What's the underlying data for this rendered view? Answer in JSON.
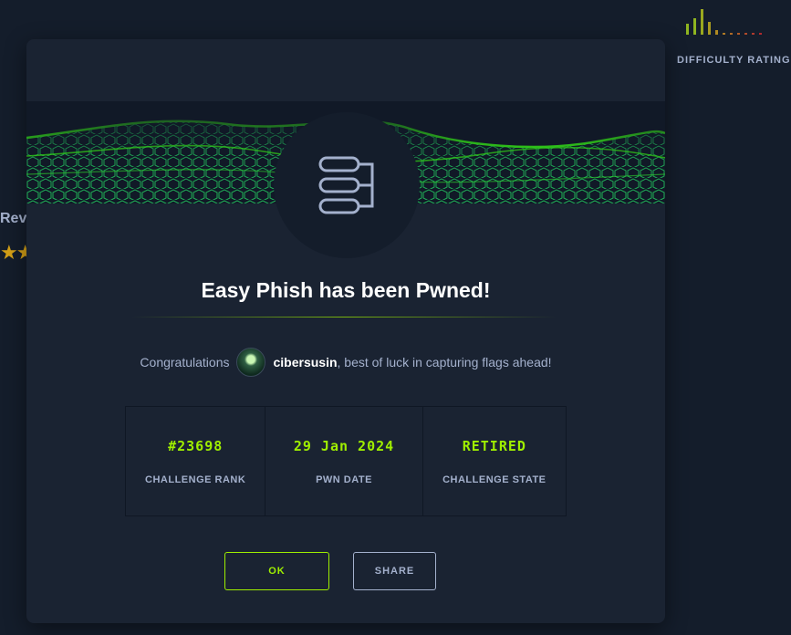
{
  "background": {
    "rev_text": "Rev",
    "stars": "★★",
    "difficulty_label": "DIFFICULTY RATING"
  },
  "modal": {
    "title": "Easy Phish has been Pwned!",
    "congrats_prefix": "Congratulations",
    "username": "cibersusin",
    "congrats_suffix": ", best of luck in capturing flags ahead!",
    "stats": [
      {
        "value": "#23698",
        "label": "CHALLENGE RANK"
      },
      {
        "value": "29 Jan 2024",
        "label": "PWN DATE"
      },
      {
        "value": "RETIRED",
        "label": "CHALLENGE STATE"
      }
    ],
    "ok_label": "OK",
    "share_label": "SHARE"
  },
  "icons": {
    "badge": "database-icon",
    "avatar": "user-avatar"
  },
  "colors": {
    "accent": "#9fef00",
    "background": "#141d2b",
    "modal": "#1a2332",
    "muted_text": "#a4b1cd"
  }
}
